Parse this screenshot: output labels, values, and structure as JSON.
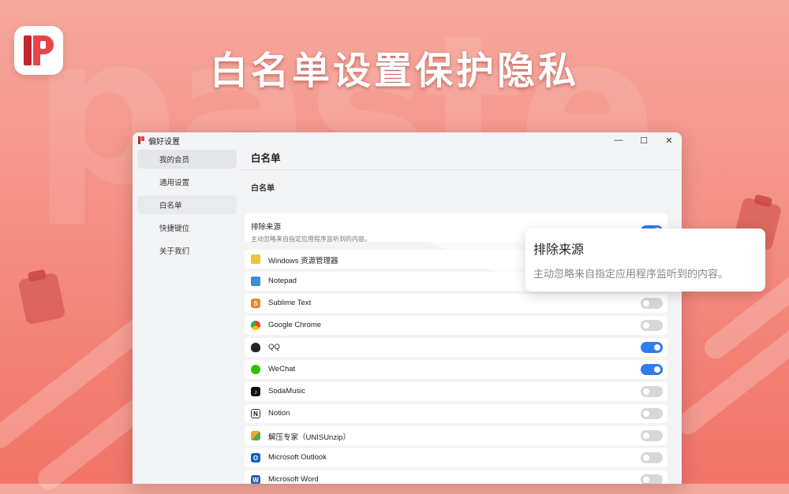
{
  "banner": {
    "headline": "白名单设置保护隐私",
    "background_word": "paste",
    "logo_icon": "paste-app-logo-icon"
  },
  "window": {
    "title": "偏好设置",
    "controls": {
      "minimize": "—",
      "maximize": "☐",
      "close": "✕"
    }
  },
  "sidebar": {
    "items": [
      {
        "label": "我的会员"
      },
      {
        "label": "通用设置"
      },
      {
        "label": "白名单"
      },
      {
        "label": "快捷键位"
      },
      {
        "label": "关于我们"
      }
    ]
  },
  "main": {
    "page_title": "白名单",
    "section_title": "白名单",
    "exclude": {
      "label": "排除来源",
      "description": "主动忽略来自指定应用程序监听到的内容。",
      "enabled": true
    },
    "apps": [
      {
        "name": "Windows 资源管理器",
        "icon": "folder-icon",
        "enabled": false
      },
      {
        "name": "Notepad",
        "icon": "notepad-icon",
        "enabled": false
      },
      {
        "name": "Sublime Text",
        "icon": "sublime-text-icon",
        "enabled": false
      },
      {
        "name": "Google Chrome",
        "icon": "chrome-icon",
        "enabled": false
      },
      {
        "name": "QQ",
        "icon": "qq-icon",
        "enabled": true
      },
      {
        "name": "WeChat",
        "icon": "wechat-icon",
        "enabled": true
      },
      {
        "name": "SodaMusic",
        "icon": "sodamusic-icon",
        "enabled": false
      },
      {
        "name": "Notion",
        "icon": "notion-icon",
        "enabled": false
      },
      {
        "name": "解压专家（UNISUnzip）",
        "icon": "unzip-icon",
        "enabled": false
      },
      {
        "name": "Microsoft Outlook",
        "icon": "outlook-icon",
        "enabled": false
      },
      {
        "name": "Microsoft Word",
        "icon": "word-icon",
        "enabled": false
      }
    ]
  },
  "callout": {
    "title": "排除来源",
    "description": "主动忽略来自指定应用程序监听到的内容。"
  },
  "colors": {
    "accent": "#2f7bf0",
    "background": "#f48a7e",
    "toggle_off": "#d6d7da"
  }
}
